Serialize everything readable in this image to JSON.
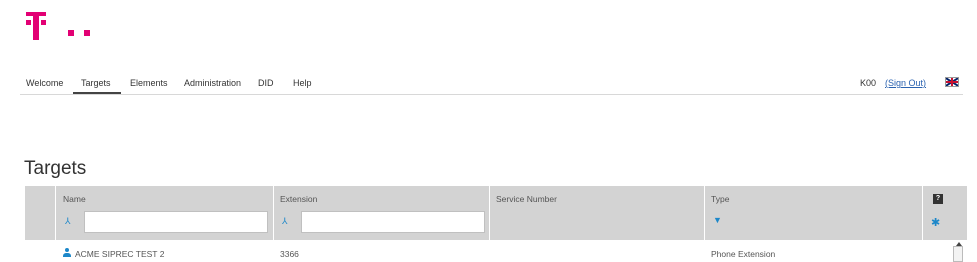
{
  "brand": {
    "color": "#e20074"
  },
  "nav": {
    "items": [
      {
        "label": "Welcome"
      },
      {
        "label": "Targets"
      },
      {
        "label": "Elements"
      },
      {
        "label": "Administration"
      },
      {
        "label": "DID"
      },
      {
        "label": "Help"
      }
    ],
    "active": "Targets"
  },
  "user": {
    "name": "K00",
    "sign_out": "(Sign Out)",
    "language_flag": "uk-flag-icon"
  },
  "page": {
    "title": "Targets"
  },
  "grid": {
    "columns": [
      {
        "label": "Name"
      },
      {
        "label": "Extension"
      },
      {
        "label": "Service Number"
      },
      {
        "label": "Type"
      }
    ],
    "filters": {
      "name": {
        "value": "",
        "icon": "filter-operator-icon"
      },
      "extension": {
        "value": "",
        "icon": "filter-operator-icon"
      },
      "type": {
        "icon": "funnel-icon"
      }
    },
    "help_label": "?",
    "rows": [
      {
        "name": "ACME SIPREC TEST 2",
        "extension": "3366",
        "service_number": "",
        "type": "Phone Extension"
      }
    ]
  },
  "colors": {
    "accent": "#1c87c9",
    "header_bg": "#d3d3d3",
    "link": "#2a62b0"
  }
}
